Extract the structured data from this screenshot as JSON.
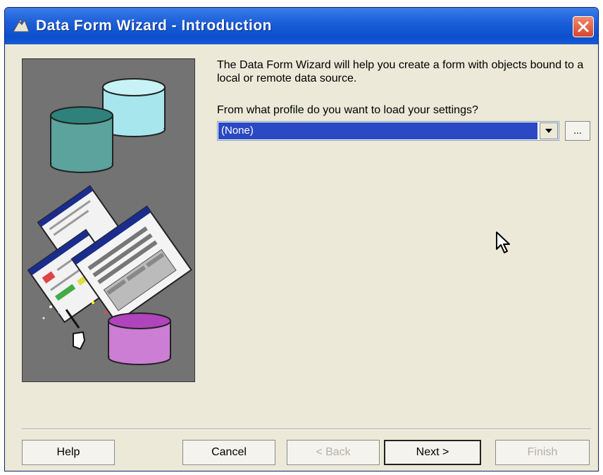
{
  "window": {
    "title": "Data Form Wizard - Introduction",
    "title_bar_color": "#1c5fd8"
  },
  "content": {
    "intro_text": "The Data Form Wizard will help you create a form with objects bound to a local or remote data source.",
    "prompt": "From what profile do you want to load your settings?",
    "profile_select": {
      "value": "(None)",
      "highlight_color": "#2a49c2"
    },
    "browse_label": "..."
  },
  "buttons": {
    "help": "Help",
    "cancel": "Cancel",
    "back": "< Back",
    "next": "Next >",
    "finish": "Finish"
  },
  "icons": [
    "app-icon",
    "close-icon",
    "chevron-down-icon",
    "mouse-cursor-icon"
  ]
}
